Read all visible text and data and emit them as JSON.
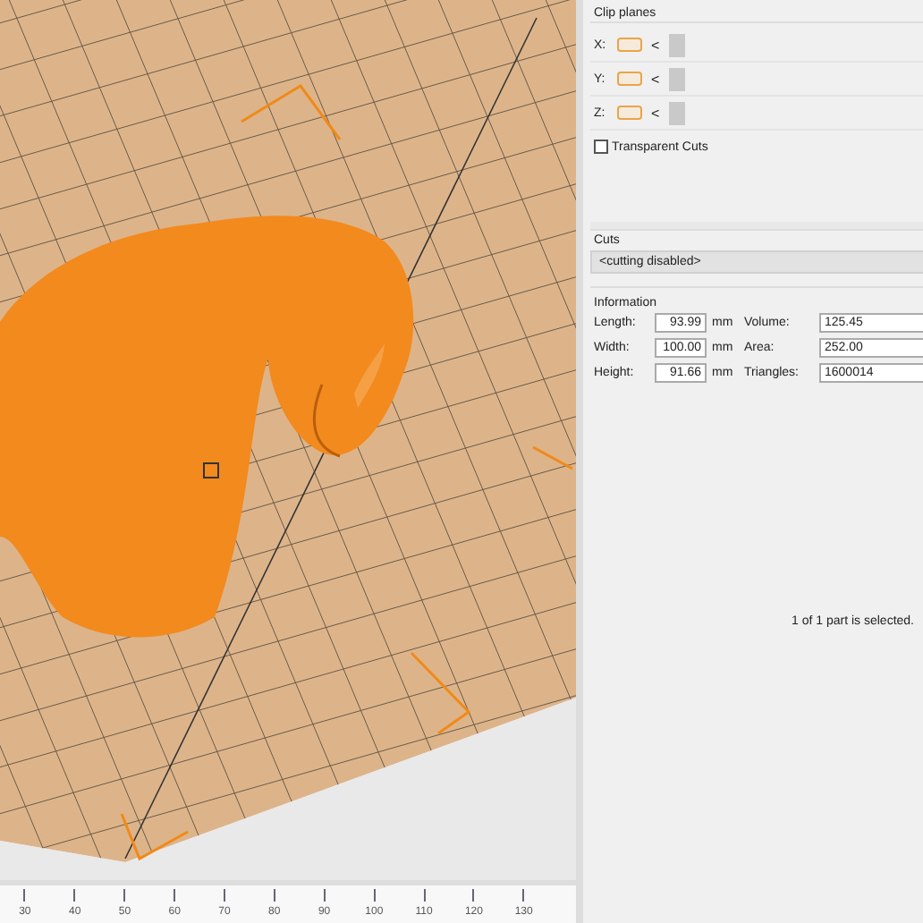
{
  "viewport": {
    "ruler_labels": [
      "30",
      "40",
      "50",
      "60",
      "70",
      "80",
      "90",
      "100",
      "110",
      "120",
      "130"
    ]
  },
  "clip_planes": {
    "title": "Clip planes",
    "axes": [
      {
        "label": "X:",
        "arrow": "<"
      },
      {
        "label": "Y:",
        "arrow": "<"
      },
      {
        "label": "Z:",
        "arrow": "<"
      }
    ],
    "transparent_cuts": {
      "label": "Transparent Cuts",
      "checked": false
    }
  },
  "cuts": {
    "title": "Cuts",
    "selection": "<cutting disabled>"
  },
  "information": {
    "title": "Information",
    "rows": [
      {
        "label": "Length:",
        "value": "93.99",
        "unit": "mm",
        "label2": "Volume:",
        "value2": "125.45"
      },
      {
        "label": "Width:",
        "value": "100.00",
        "unit": "mm",
        "label2": "Area:",
        "value2": "252.00"
      },
      {
        "label": "Height:",
        "value": "91.66",
        "unit": "mm",
        "label2": "Triangles:",
        "value2": "1600014"
      }
    ]
  },
  "status": "1 of 1 part is selected."
}
